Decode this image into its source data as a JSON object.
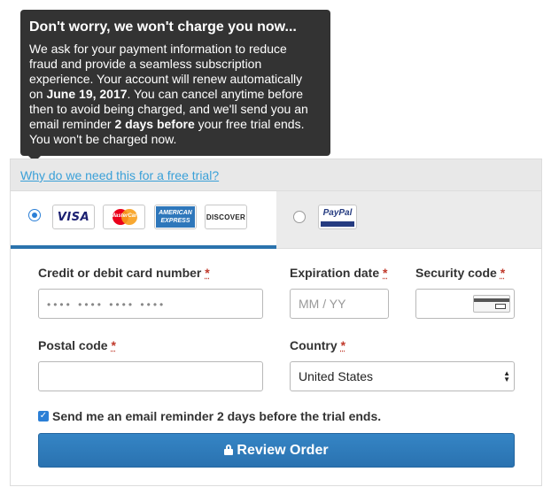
{
  "tooltip": {
    "title": "Don't worry, we won't charge you now...",
    "line1": "We ask for your payment information to reduce",
    "line2": "fraud and provide a seamless subscription",
    "line3": "experience. Your account will renew automatically",
    "line4_pre": "on ",
    "line4_date": "June 19, 2017",
    "line4_post": ". You can cancel anytime before",
    "line5": "then to avoid being charged, and we'll send you an",
    "line6_pre": "email reminder ",
    "line6_bold": "2 days before",
    "line6_post": " your free trial ends.",
    "line7": "You won't be charged now."
  },
  "why_link": "Why do we need this for a free trial?",
  "payment_methods": {
    "visa": "VISA",
    "mastercard": "MasterCard",
    "amex_line1": "AMERICAN",
    "amex_line2": "EXPRESS",
    "discover": "DISCOVER",
    "paypal": "PayPal",
    "selected": "card"
  },
  "form": {
    "card_number": {
      "label": "Credit or debit card number",
      "required": "*",
      "placeholder": "•••• •••• •••• ••••"
    },
    "expiration": {
      "label": "Expiration date",
      "required": "*",
      "placeholder": "MM / YY"
    },
    "security": {
      "label": "Security code",
      "required": "*"
    },
    "postal": {
      "label": "Postal code",
      "required": "*",
      "value": ""
    },
    "country": {
      "label": "Country",
      "required": "*",
      "value": "United States"
    }
  },
  "reminder_checkbox": {
    "label": "Send me an email reminder 2 days before the trial ends.",
    "checked": true
  },
  "review_button": "Review Order",
  "colors": {
    "accent": "#2a73ad",
    "link": "#3aa0d8",
    "tooltip_bg": "#333333",
    "required": "#c0392b"
  }
}
